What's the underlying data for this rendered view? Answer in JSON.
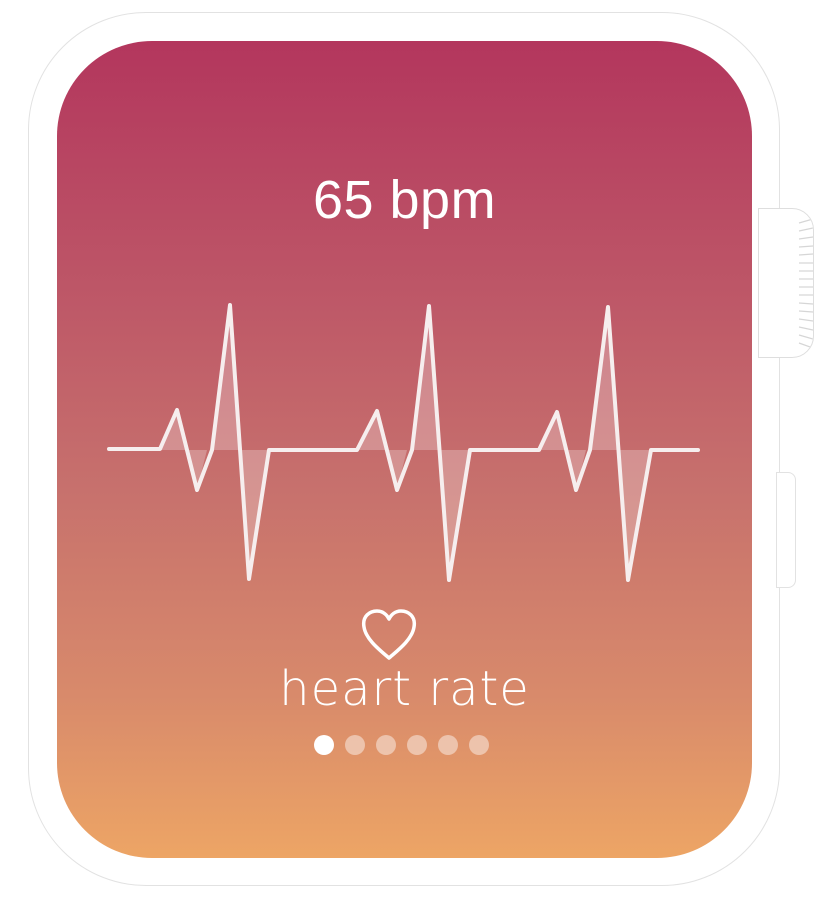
{
  "heart_rate": {
    "value_text": "65 bpm",
    "label": "heart rate",
    "icon": "heart-outline-icon"
  },
  "pager": {
    "total": 6,
    "active_index": 0
  },
  "colors": {
    "gradient_top": "#b3365d",
    "gradient_bottom": "#eda565",
    "text": "#ffffff"
  }
}
